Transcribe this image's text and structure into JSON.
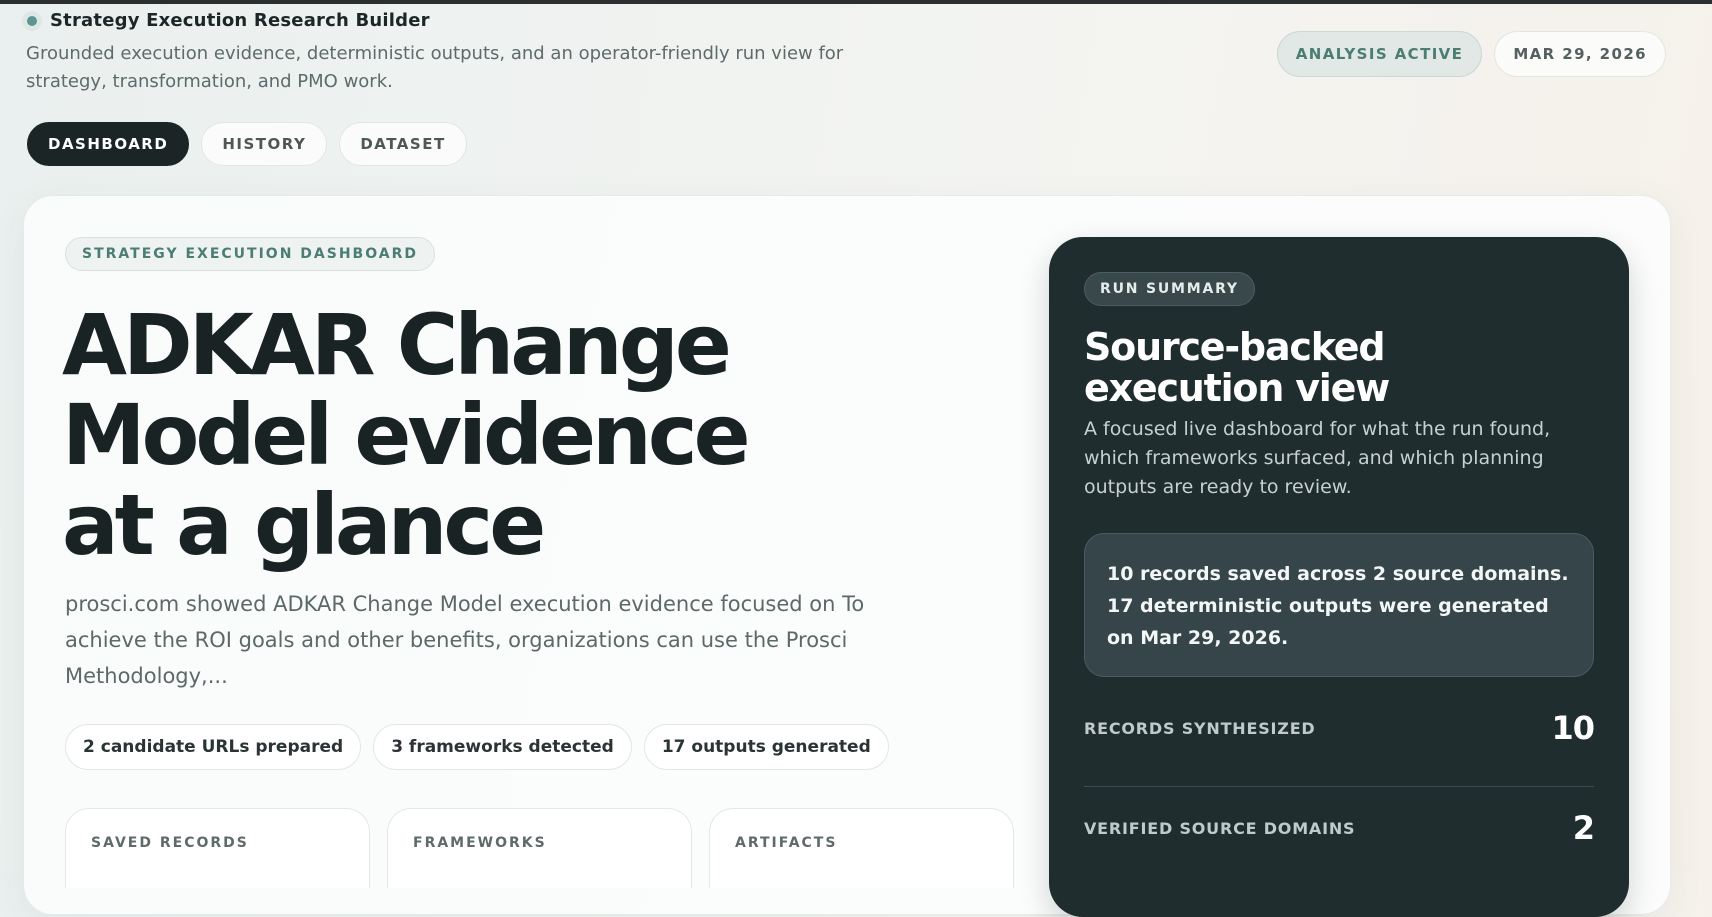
{
  "app": {
    "title": "Strategy Execution Research Builder",
    "subtitle": "Grounded execution evidence, deterministic outputs, and an operator-friendly run view for strategy, transformation, and PMO work."
  },
  "status": {
    "analysis": "ANALYSIS ACTIVE",
    "date": "MAR 29, 2026"
  },
  "nav": {
    "tabs": [
      {
        "label": "DASHBOARD",
        "active": true
      },
      {
        "label": "HISTORY",
        "active": false
      },
      {
        "label": "DATASET",
        "active": false
      }
    ]
  },
  "hero": {
    "kicker": "STRATEGY EXECUTION DASHBOARD",
    "headline_lines": [
      "ADKAR Change",
      "Model evidence",
      "at a glance"
    ],
    "lead": "prosci.com showed ADKAR Change Model execution evidence focused on To achieve the ROI goals and other benefits, organizations can use the Prosci Methodology,...",
    "chips": [
      "2 candidate URLs prepared",
      "3 frameworks detected",
      "17 outputs generated"
    ],
    "stat_cards": [
      {
        "label": "SAVED RECORDS"
      },
      {
        "label": "FRAMEWORKS"
      },
      {
        "label": "ARTIFACTS"
      }
    ]
  },
  "summary": {
    "badge": "RUN SUMMARY",
    "title": "Source-backed execution view",
    "description": "A focused live dashboard for what the run found, which frameworks surfaced, and which planning outputs are ready to review.",
    "box_text": "10 records saved across 2 source domains. 17 deterministic outputs were generated on Mar 29, 2026.",
    "metrics": [
      {
        "label": "RECORDS SYNTHESIZED",
        "value": "10"
      },
      {
        "label": "VERIFIED SOURCE DOMAINS",
        "value": "2"
      }
    ]
  },
  "colors": {
    "accent": "#4b7d73",
    "dark_panel": "#1f2d2f",
    "active_tab": "#1b2526"
  }
}
